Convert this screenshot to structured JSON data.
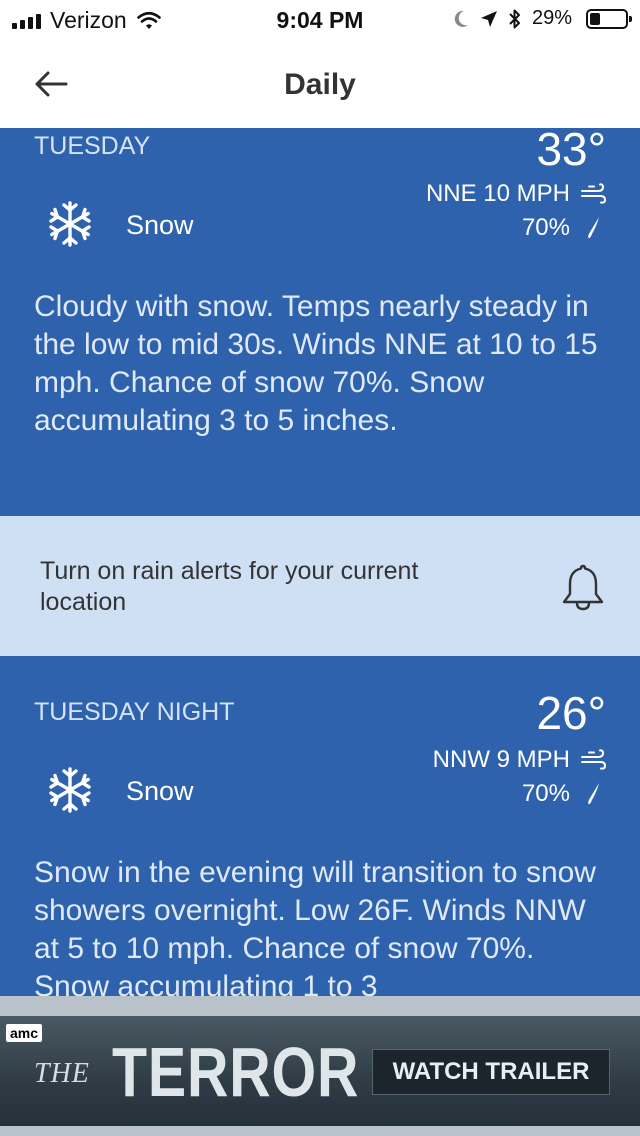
{
  "status_bar": {
    "carrier": "Verizon",
    "time": "9:04 PM",
    "battery_percent": "29%",
    "battery_level": 0.29,
    "icons": [
      "signal-bars-icon",
      "wifi-icon",
      "moon-icon",
      "location-arrow-icon",
      "bluetooth-icon",
      "battery-icon"
    ]
  },
  "nav": {
    "title": "Daily",
    "back_icon": "back-arrow-icon"
  },
  "forecasts": [
    {
      "period": "TUESDAY",
      "temp": "33°",
      "wind": "NNE 10 MPH",
      "precip": "70%",
      "condition": "Snow",
      "condition_icon": "snowflake-icon",
      "narrative": "Cloudy with snow. Temps nearly steady in the low to mid 30s. Winds NNE at 10 to 15 mph. Chance of snow 70%. Snow accumulating 3 to 5 inches."
    },
    {
      "period": "TUESDAY NIGHT",
      "temp": "26°",
      "wind": "NNW 9 MPH",
      "precip": "70%",
      "condition": "Snow",
      "condition_icon": "snowflake-icon",
      "narrative": "Snow in the evening will transition to snow showers overnight. Low 26F. Winds NNW at 5 to 10 mph. Chance of snow 70%. Snow accumulating 1 to 3"
    }
  ],
  "alert_banner": {
    "text": "Turn on rain alerts for your current location",
    "icon": "bell-icon"
  },
  "ad": {
    "network": "amc",
    "title_prefix": "THE",
    "title": "TERROR",
    "cta": "WATCH TRAILER"
  },
  "colors": {
    "card_blue": "#2f62ad",
    "alert_light_blue": "#cfe0f4",
    "nav_text": "#333333"
  }
}
